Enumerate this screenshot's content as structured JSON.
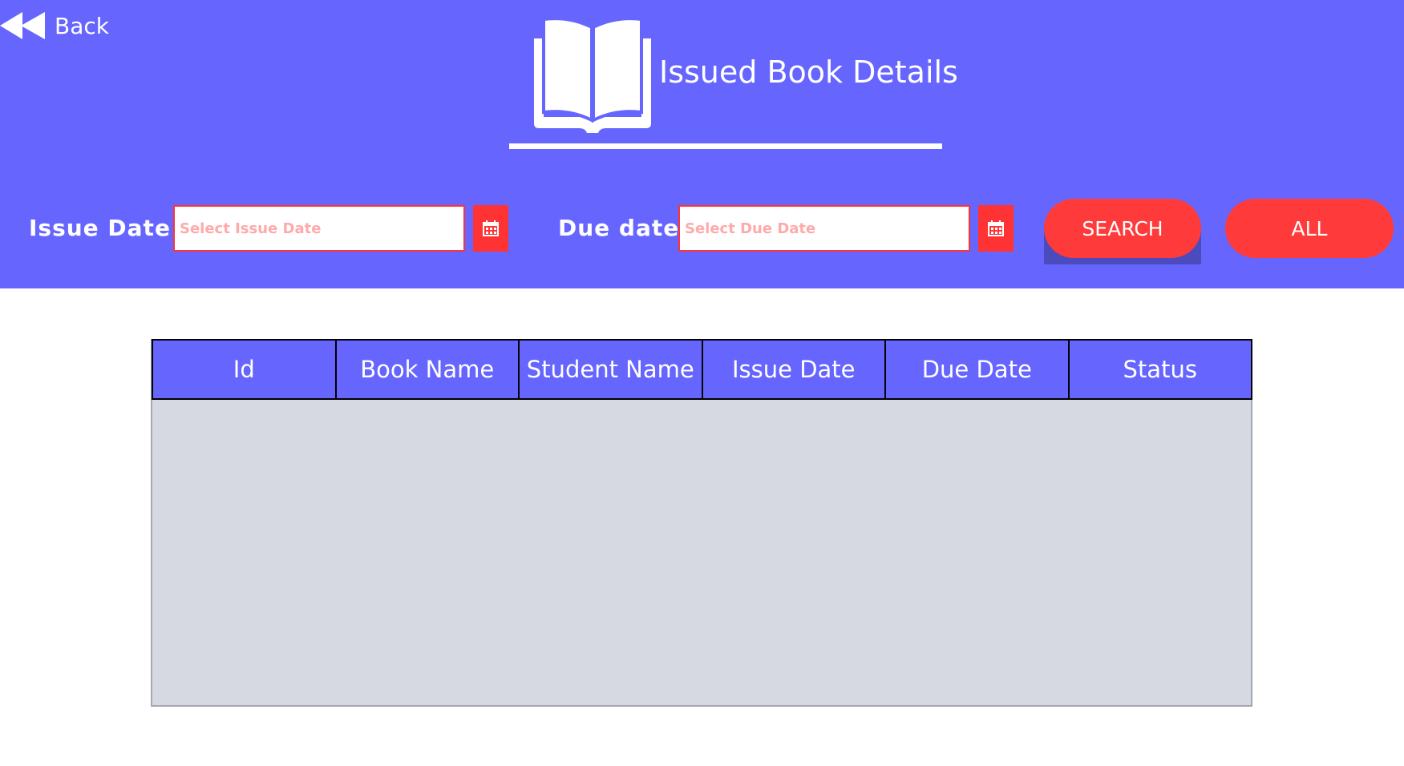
{
  "header": {
    "back_label": "Back",
    "title": "Issued Book Details"
  },
  "filters": {
    "issue_date_label": "Issue Date :",
    "issue_date_placeholder": "Select Issue Date",
    "issue_date_value": "",
    "due_date_label": "Due date :",
    "due_date_placeholder": "Select Due Date",
    "due_date_value": "",
    "search_label": "SEARCH",
    "all_label": "ALL"
  },
  "table": {
    "columns": [
      "Id",
      "Book Name",
      "Student Name",
      "Issue Date",
      "Due Date",
      "Status"
    ],
    "rows": []
  },
  "icons": {
    "back": "rewind-icon",
    "logo": "open-book-icon",
    "calendar": "calendar-icon"
  },
  "colors": {
    "primary": "#6666ff",
    "accent": "#ff3a3a",
    "table_body": "#d6d9e2"
  }
}
